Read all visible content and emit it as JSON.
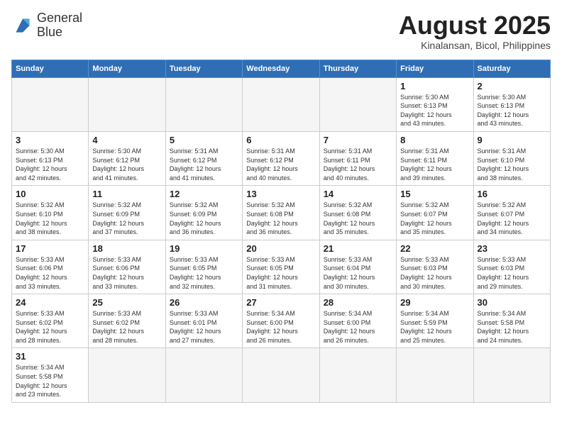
{
  "header": {
    "logo_line1": "General",
    "logo_line2": "Blue",
    "title": "August 2025",
    "subtitle": "Kinalansan, Bicol, Philippines"
  },
  "weekdays": [
    "Sunday",
    "Monday",
    "Tuesday",
    "Wednesday",
    "Thursday",
    "Friday",
    "Saturday"
  ],
  "weeks": [
    [
      {
        "day": "",
        "info": ""
      },
      {
        "day": "",
        "info": ""
      },
      {
        "day": "",
        "info": ""
      },
      {
        "day": "",
        "info": ""
      },
      {
        "day": "",
        "info": ""
      },
      {
        "day": "1",
        "info": "Sunrise: 5:30 AM\nSunset: 6:13 PM\nDaylight: 12 hours\nand 43 minutes."
      },
      {
        "day": "2",
        "info": "Sunrise: 5:30 AM\nSunset: 6:13 PM\nDaylight: 12 hours\nand 43 minutes."
      }
    ],
    [
      {
        "day": "3",
        "info": "Sunrise: 5:30 AM\nSunset: 6:13 PM\nDaylight: 12 hours\nand 42 minutes."
      },
      {
        "day": "4",
        "info": "Sunrise: 5:30 AM\nSunset: 6:12 PM\nDaylight: 12 hours\nand 41 minutes."
      },
      {
        "day": "5",
        "info": "Sunrise: 5:31 AM\nSunset: 6:12 PM\nDaylight: 12 hours\nand 41 minutes."
      },
      {
        "day": "6",
        "info": "Sunrise: 5:31 AM\nSunset: 6:12 PM\nDaylight: 12 hours\nand 40 minutes."
      },
      {
        "day": "7",
        "info": "Sunrise: 5:31 AM\nSunset: 6:11 PM\nDaylight: 12 hours\nand 40 minutes."
      },
      {
        "day": "8",
        "info": "Sunrise: 5:31 AM\nSunset: 6:11 PM\nDaylight: 12 hours\nand 39 minutes."
      },
      {
        "day": "9",
        "info": "Sunrise: 5:31 AM\nSunset: 6:10 PM\nDaylight: 12 hours\nand 38 minutes."
      }
    ],
    [
      {
        "day": "10",
        "info": "Sunrise: 5:32 AM\nSunset: 6:10 PM\nDaylight: 12 hours\nand 38 minutes."
      },
      {
        "day": "11",
        "info": "Sunrise: 5:32 AM\nSunset: 6:09 PM\nDaylight: 12 hours\nand 37 minutes."
      },
      {
        "day": "12",
        "info": "Sunrise: 5:32 AM\nSunset: 6:09 PM\nDaylight: 12 hours\nand 36 minutes."
      },
      {
        "day": "13",
        "info": "Sunrise: 5:32 AM\nSunset: 6:08 PM\nDaylight: 12 hours\nand 36 minutes."
      },
      {
        "day": "14",
        "info": "Sunrise: 5:32 AM\nSunset: 6:08 PM\nDaylight: 12 hours\nand 35 minutes."
      },
      {
        "day": "15",
        "info": "Sunrise: 5:32 AM\nSunset: 6:07 PM\nDaylight: 12 hours\nand 35 minutes."
      },
      {
        "day": "16",
        "info": "Sunrise: 5:32 AM\nSunset: 6:07 PM\nDaylight: 12 hours\nand 34 minutes."
      }
    ],
    [
      {
        "day": "17",
        "info": "Sunrise: 5:33 AM\nSunset: 6:06 PM\nDaylight: 12 hours\nand 33 minutes."
      },
      {
        "day": "18",
        "info": "Sunrise: 5:33 AM\nSunset: 6:06 PM\nDaylight: 12 hours\nand 33 minutes."
      },
      {
        "day": "19",
        "info": "Sunrise: 5:33 AM\nSunset: 6:05 PM\nDaylight: 12 hours\nand 32 minutes."
      },
      {
        "day": "20",
        "info": "Sunrise: 5:33 AM\nSunset: 6:05 PM\nDaylight: 12 hours\nand 31 minutes."
      },
      {
        "day": "21",
        "info": "Sunrise: 5:33 AM\nSunset: 6:04 PM\nDaylight: 12 hours\nand 30 minutes."
      },
      {
        "day": "22",
        "info": "Sunrise: 5:33 AM\nSunset: 6:03 PM\nDaylight: 12 hours\nand 30 minutes."
      },
      {
        "day": "23",
        "info": "Sunrise: 5:33 AM\nSunset: 6:03 PM\nDaylight: 12 hours\nand 29 minutes."
      }
    ],
    [
      {
        "day": "24",
        "info": "Sunrise: 5:33 AM\nSunset: 6:02 PM\nDaylight: 12 hours\nand 28 minutes."
      },
      {
        "day": "25",
        "info": "Sunrise: 5:33 AM\nSunset: 6:02 PM\nDaylight: 12 hours\nand 28 minutes."
      },
      {
        "day": "26",
        "info": "Sunrise: 5:33 AM\nSunset: 6:01 PM\nDaylight: 12 hours\nand 27 minutes."
      },
      {
        "day": "27",
        "info": "Sunrise: 5:34 AM\nSunset: 6:00 PM\nDaylight: 12 hours\nand 26 minutes."
      },
      {
        "day": "28",
        "info": "Sunrise: 5:34 AM\nSunset: 6:00 PM\nDaylight: 12 hours\nand 26 minutes."
      },
      {
        "day": "29",
        "info": "Sunrise: 5:34 AM\nSunset: 5:59 PM\nDaylight: 12 hours\nand 25 minutes."
      },
      {
        "day": "30",
        "info": "Sunrise: 5:34 AM\nSunset: 5:58 PM\nDaylight: 12 hours\nand 24 minutes."
      }
    ],
    [
      {
        "day": "31",
        "info": "Sunrise: 5:34 AM\nSunset: 5:58 PM\nDaylight: 12 hours\nand 23 minutes."
      },
      {
        "day": "",
        "info": ""
      },
      {
        "day": "",
        "info": ""
      },
      {
        "day": "",
        "info": ""
      },
      {
        "day": "",
        "info": ""
      },
      {
        "day": "",
        "info": ""
      },
      {
        "day": "",
        "info": ""
      }
    ]
  ]
}
